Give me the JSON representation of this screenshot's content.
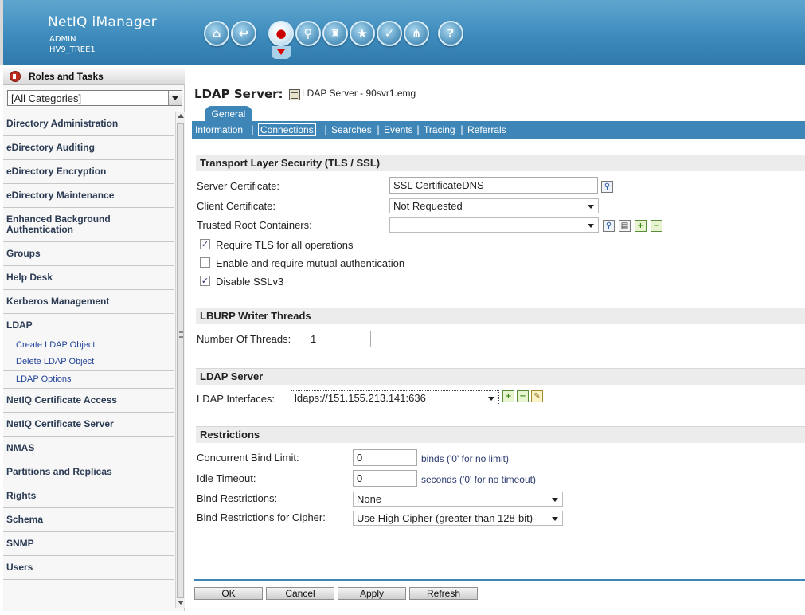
{
  "header": {
    "app_title": "NetIQ iManager",
    "user": "ADMIN",
    "tree": "HV9_TREE1",
    "icons": [
      "home-icon",
      "back-icon",
      "roles-icon",
      "search-icon",
      "tree-icon",
      "favorites-icon",
      "tasks-icon",
      "hierarchy-icon",
      "help-icon"
    ]
  },
  "sidebar": {
    "title": "Roles and Tasks",
    "category": "[All Categories]",
    "items": [
      {
        "label": "Directory Administration"
      },
      {
        "label": "eDirectory Auditing"
      },
      {
        "label": "eDirectory Encryption"
      },
      {
        "label": "eDirectory Maintenance"
      },
      {
        "label": "Enhanced Background Authentication"
      },
      {
        "label": "Groups"
      },
      {
        "label": "Help Desk"
      },
      {
        "label": "Kerberos Management"
      },
      {
        "label": "LDAP"
      }
    ],
    "ldap_subitems": [
      "Create LDAP Object",
      "Delete LDAP Object",
      "LDAP Options"
    ],
    "items_after": [
      {
        "label": "NetIQ Certificate Access"
      },
      {
        "label": "NetIQ Certificate Server"
      },
      {
        "label": "NMAS"
      },
      {
        "label": "Partitions and Replicas"
      },
      {
        "label": "Rights"
      },
      {
        "label": "Schema"
      },
      {
        "label": "SNMP"
      },
      {
        "label": "Users"
      }
    ]
  },
  "main": {
    "title": "LDAP Server:",
    "object_name": "LDAP Server - 90svr1.emg",
    "tab_general": "General",
    "subtabs": [
      "Information",
      "Connections",
      "Searches",
      "Events",
      "Tracing",
      "Referrals"
    ],
    "selected_subtab": "Connections",
    "tls": {
      "heading": "Transport Layer Security (TLS / SSL)",
      "server_cert_label": "Server Certificate:",
      "server_cert_value": "SSL CertificateDNS",
      "client_cert_label": "Client Certificate:",
      "client_cert_value": "Not Requested",
      "trusted_root_label": "Trusted Root Containers:",
      "trusted_root_value": "",
      "require_tls_label": "Require TLS for all operations",
      "require_tls_checked": true,
      "mutual_auth_label": "Enable and require mutual authentication",
      "mutual_auth_checked": false,
      "disable_sslv3_label": "Disable SSLv3",
      "disable_sslv3_checked": true
    },
    "lburp": {
      "heading": "LBURP Writer Threads",
      "threads_label": "Number Of Threads:",
      "threads_value": "1"
    },
    "ldap_server": {
      "heading": "LDAP Server",
      "interfaces_label": "LDAP Interfaces:",
      "interfaces_value": "ldaps://151.155.213.141:636"
    },
    "restrictions": {
      "heading": "Restrictions",
      "bind_limit_label": "Concurrent Bind Limit:",
      "bind_limit_value": "0",
      "bind_limit_hint": "binds ('0' for no limit)",
      "idle_label": "Idle Timeout:",
      "idle_value": "0",
      "idle_hint": "seconds ('0' for no timeout)",
      "bind_restr_label": "Bind Restrictions:",
      "bind_restr_value": "None",
      "cipher_label": "Bind Restrictions for Cipher:",
      "cipher_value": "Use High Cipher (greater than 128-bit)"
    },
    "buttons": {
      "ok": "OK",
      "cancel": "Cancel",
      "apply": "Apply",
      "refresh": "Refresh"
    }
  },
  "colors": {
    "header_blue": "#3d8bbd",
    "tab_blue": "#3f86b8",
    "nav_text": "#2b3b54"
  }
}
